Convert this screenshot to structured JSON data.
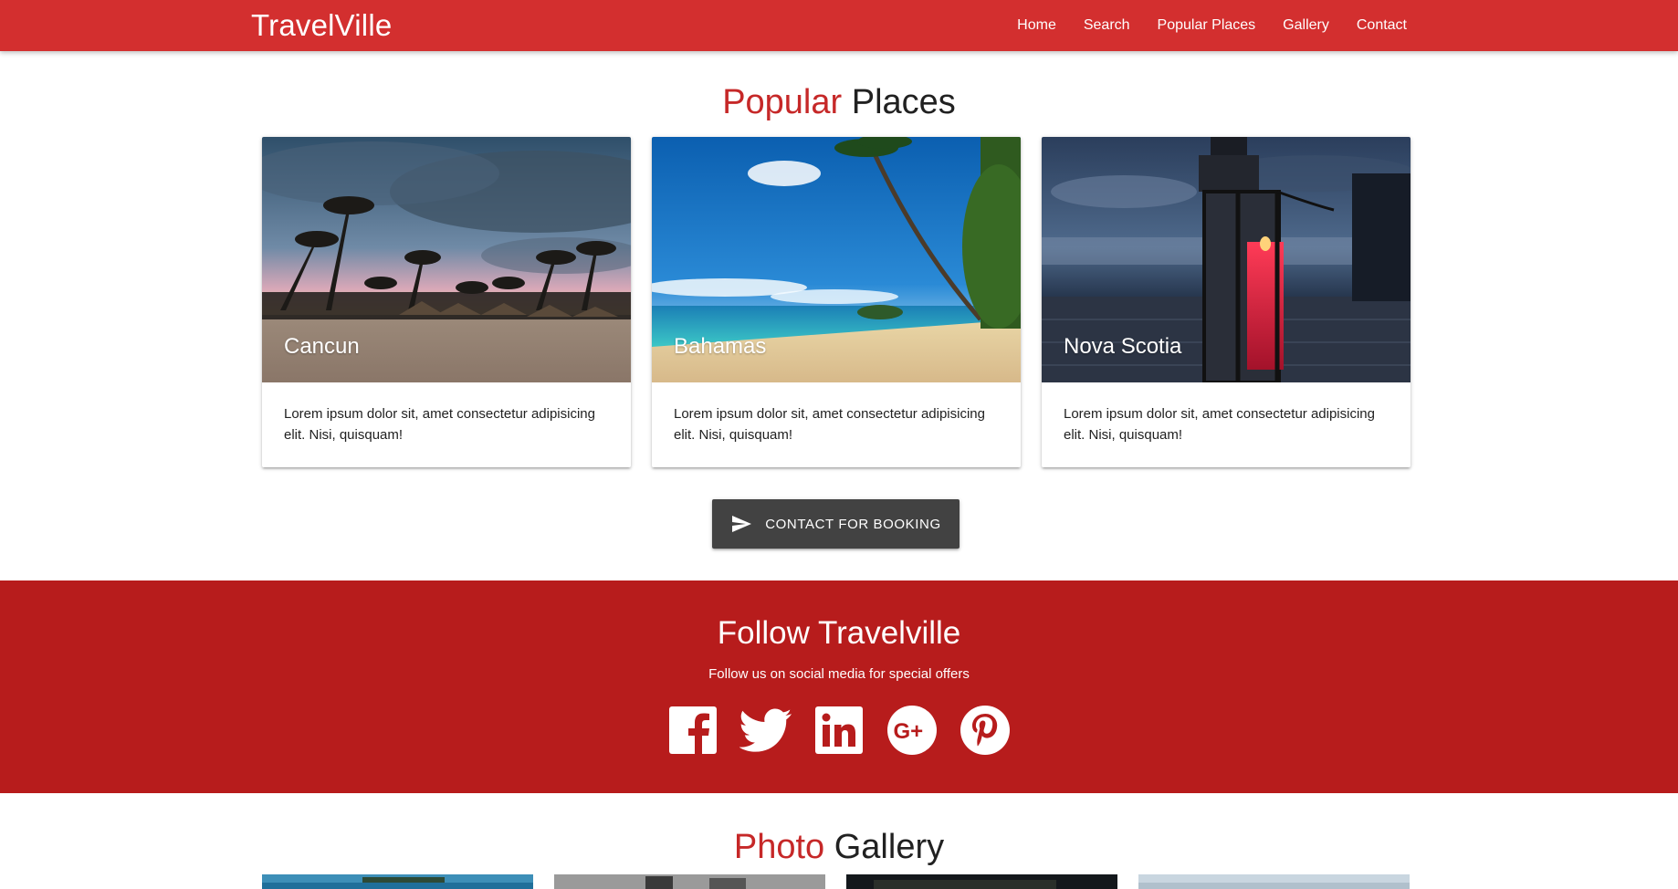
{
  "navbar": {
    "brand": "TravelVille",
    "links": [
      "Home",
      "Search",
      "Popular Places",
      "Gallery",
      "Contact"
    ]
  },
  "popular": {
    "title_accent": "Popular",
    "title_rest": " Places",
    "cards": [
      {
        "title": "Cancun",
        "text": "Lorem ipsum dolor sit, amet consectetur adipisicing elit. Nisi, quisquam!"
      },
      {
        "title": "Bahamas",
        "text": "Lorem ipsum dolor sit, amet consectetur adipisicing elit. Nisi, quisquam!"
      },
      {
        "title": "Nova Scotia",
        "text": "Lorem ipsum dolor sit, amet consectetur adipisicing elit. Nisi, quisquam!"
      }
    ],
    "button_label": "Contact for Booking",
    "button_icon": "send-icon"
  },
  "follow": {
    "title": "Follow Travelville",
    "subtitle": "Follow us on social media for special offers",
    "icons": [
      "facebook-icon",
      "twitter-icon",
      "linkedin-icon",
      "google-plus-icon",
      "pinterest-icon"
    ]
  },
  "gallery": {
    "title_accent": "Photo",
    "title_rest": " Gallery"
  },
  "colors": {
    "navbar": "#d32f2f",
    "accent_text": "#c62828",
    "follow_bg": "#b71c1c",
    "button_bg": "#424242"
  }
}
